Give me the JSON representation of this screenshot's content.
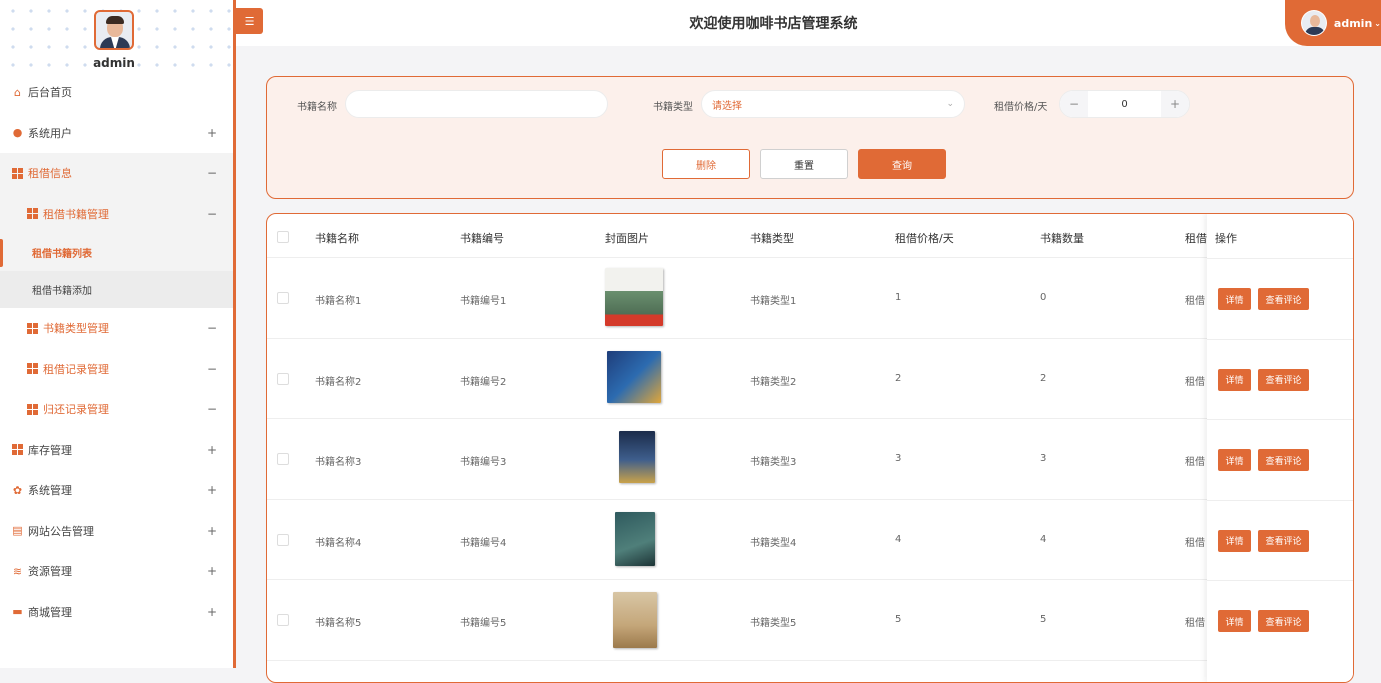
{
  "app": {
    "title": "欢迎使用咖啡书店管理系统",
    "username": "admin",
    "accent": "#e06a36"
  },
  "sidebar": {
    "username": "admin",
    "items": [
      {
        "label": "后台首页",
        "icon": "home-icon"
      },
      {
        "label": "系统用户",
        "icon": "user-icon",
        "toggle": "+"
      },
      {
        "label": "租借信息",
        "icon": "grid-icon",
        "toggle": "−"
      },
      {
        "label": "租借书籍管理",
        "icon": "grid-icon",
        "toggle": "−"
      },
      {
        "label": "租借书籍列表"
      },
      {
        "label": "租借书籍添加"
      },
      {
        "label": "书籍类型管理",
        "icon": "grid-icon",
        "toggle": "−"
      },
      {
        "label": "租借记录管理",
        "icon": "grid-icon",
        "toggle": "−"
      },
      {
        "label": "归还记录管理",
        "icon": "grid-icon",
        "toggle": "−"
      },
      {
        "label": "库存管理",
        "icon": "grid-icon",
        "toggle": "+"
      },
      {
        "label": "系统管理",
        "icon": "gear-icon",
        "toggle": "+"
      },
      {
        "label": "网站公告管理",
        "icon": "notice-icon",
        "toggle": "+"
      },
      {
        "label": "资源管理",
        "icon": "database-icon",
        "toggle": "+"
      },
      {
        "label": "商城管理",
        "icon": "shop-icon",
        "toggle": "+"
      }
    ]
  },
  "search": {
    "name_label": "书籍名称",
    "name_value": "",
    "type_label": "书籍类型",
    "type_placeholder": "请选择",
    "price_label": "租借价格/天",
    "price_value": "0",
    "minus": "−",
    "plus": "+",
    "delete_label": "删除",
    "reset_label": "重置",
    "query_label": "查询"
  },
  "table": {
    "headers": [
      "书籍名称",
      "书籍编号",
      "封面图片",
      "书籍类型",
      "租借价格/天",
      "书籍数量",
      "租借",
      "操作"
    ],
    "detail_label": "详情",
    "review_label": "查看评论",
    "rows": [
      {
        "name": "书籍名称1",
        "code": "书籍编号1",
        "type": "书籍类型1",
        "price": "1",
        "qty": "0",
        "extra": "租借"
      },
      {
        "name": "书籍名称2",
        "code": "书籍编号2",
        "type": "书籍类型2",
        "price": "2",
        "qty": "2",
        "extra": "租借"
      },
      {
        "name": "书籍名称3",
        "code": "书籍编号3",
        "type": "书籍类型3",
        "price": "3",
        "qty": "3",
        "extra": "租借"
      },
      {
        "name": "书籍名称4",
        "code": "书籍编号4",
        "type": "书籍类型4",
        "price": "4",
        "qty": "4",
        "extra": "租借"
      },
      {
        "name": "书籍名称5",
        "code": "书籍编号5",
        "type": "书籍类型5",
        "price": "5",
        "qty": "5",
        "extra": "租借"
      }
    ]
  }
}
